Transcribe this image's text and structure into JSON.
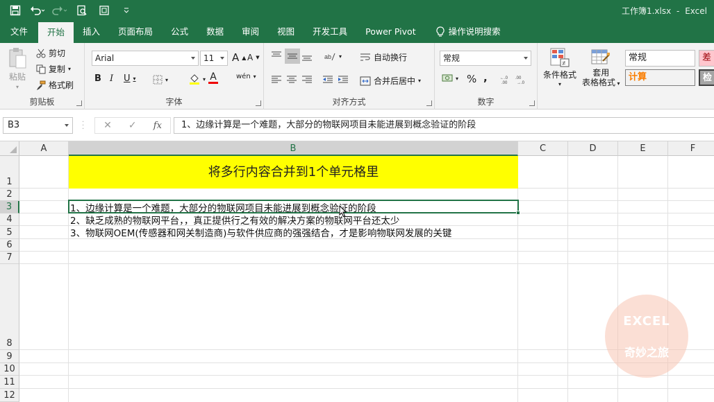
{
  "app": {
    "title": "工作簿1.xlsx",
    "separator": "-",
    "app_name": "Excel"
  },
  "tabs": [
    "文件",
    "开始",
    "插入",
    "页面布局",
    "公式",
    "数据",
    "审阅",
    "视图",
    "开发工具",
    "Power Pivot",
    "操作说明搜索"
  ],
  "ribbon": {
    "clipboard": {
      "label": "剪贴板",
      "paste": "粘贴",
      "cut": "剪切",
      "copy": "复制",
      "format_painter": "格式刷"
    },
    "font": {
      "label": "字体",
      "font_name": "Arial",
      "font_size": "11",
      "bold": "B",
      "italic": "I",
      "underline": "U",
      "grow": "A",
      "shrink": "A",
      "font_color": "A",
      "phonetic": "wén"
    },
    "alignment": {
      "label": "对齐方式",
      "wrap": "自动换行",
      "merge": "合并后居中"
    },
    "number": {
      "label": "数字",
      "format": "常规",
      "percent": "%",
      "comma": ","
    },
    "styles": {
      "conditional": "条件格式",
      "table_format_1": "套用",
      "table_format_2": "表格格式",
      "normal": "常规",
      "bad": "差",
      "calc": "计算",
      "check": "检"
    }
  },
  "formula_bar": {
    "name_box": "B3",
    "cancel": "✕",
    "enter": "✓",
    "fx": "fx",
    "content": "1、边缘计算是一个难题，大部分的物联网项目未能进展到概念验证的阶段"
  },
  "grid": {
    "columns": [
      "A",
      "B",
      "C",
      "D",
      "E",
      "F"
    ],
    "rows": [
      "1",
      "2",
      "3",
      "4",
      "5",
      "6",
      "7",
      "8",
      "9",
      "10",
      "11",
      "12"
    ],
    "selected_cell": "B3",
    "cells": {
      "B1": "将多行内容合并到1个单元格里",
      "B3": "1、边缘计算是一个难题，大部分的物联网项目未能进展到概念验证的阶段",
      "B4": "2、缺乏成熟的物联网平台，，真正提供行之有效的解决方案的物联网平台还太少",
      "B5": "3、物联网OEM(传感器和网关制造商)与软件供应商的强强结合，才是影响物联网发展的关键"
    },
    "title_fill": "#ffff00"
  },
  "watermark": {
    "line1": "EXCEL",
    "line2": "奇妙之旅"
  },
  "colors": {
    "accent": "#217346",
    "bad_bg": "#ffc7ce",
    "bad_text": "#9c0006",
    "calc_text": "#fa7d00"
  }
}
